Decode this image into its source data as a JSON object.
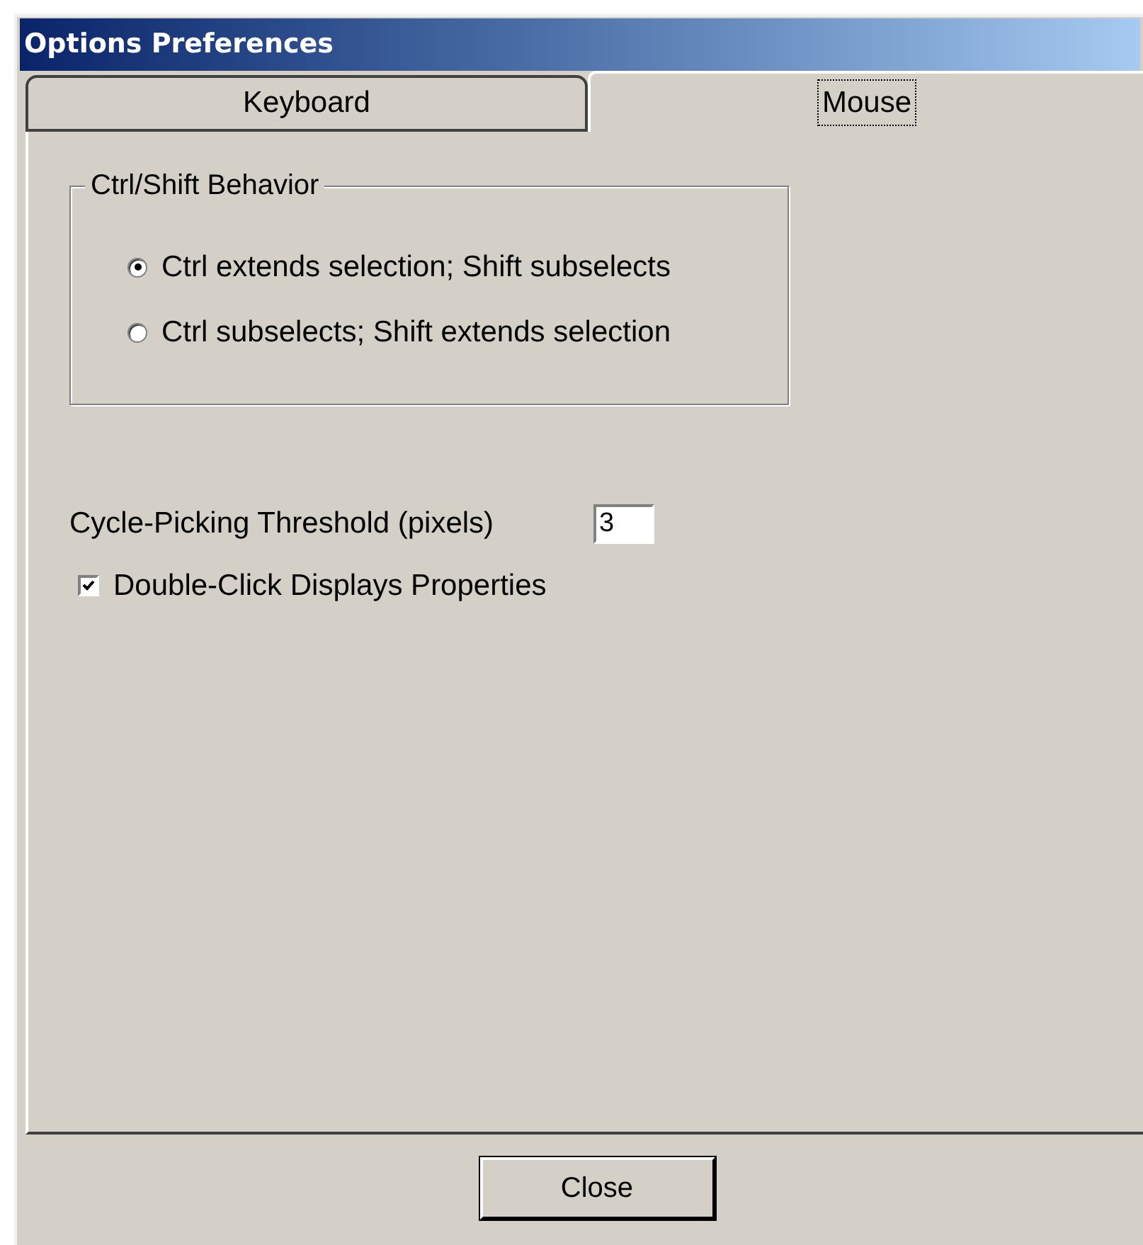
{
  "window": {
    "title": "Options Preferences"
  },
  "tabs": [
    {
      "label": "Keyboard",
      "selected": false
    },
    {
      "label": "Mouse",
      "selected": true
    }
  ],
  "group": {
    "title": "Ctrl/Shift Behavior",
    "options": [
      {
        "label": "Ctrl extends selection; Shift subselects",
        "selected": true
      },
      {
        "label": "Ctrl subselects; Shift extends selection",
        "selected": false
      }
    ]
  },
  "threshold": {
    "label": "Cycle-Picking Threshold (pixels)",
    "value": "3"
  },
  "checkbox": {
    "label": "Double-Click Displays Properties",
    "checked": true
  },
  "buttons": [
    "Close"
  ]
}
